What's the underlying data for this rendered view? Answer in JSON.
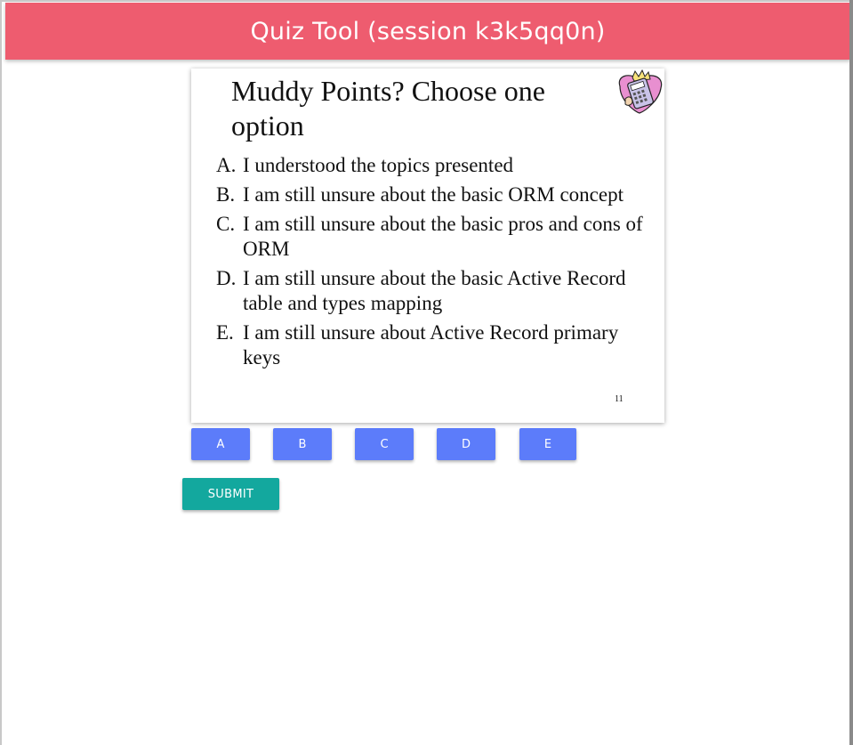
{
  "header": {
    "title": "Quiz Tool (session k3k5qq0n)",
    "color": "#ee5c6f"
  },
  "slide": {
    "title": "Muddy Points? Choose one option",
    "clipart_icon": "calculator-clipart-icon",
    "options": [
      {
        "letter": "A.",
        "text": "I understood the topics presented"
      },
      {
        "letter": "B.",
        "text": "I am still unsure about the basic ORM concept"
      },
      {
        "letter": "C.",
        "text": "I am still unsure about the basic pros and cons of ORM"
      },
      {
        "letter": "D.",
        "text": "I am still unsure about the basic Active Record table and types mapping"
      },
      {
        "letter": "E.",
        "text": "I am still unsure about Active Record primary keys"
      }
    ],
    "page_number": "11"
  },
  "answers": {
    "buttons": [
      "A",
      "B",
      "C",
      "D",
      "E"
    ],
    "color": "#5c7cfa"
  },
  "submit": {
    "label": "SUBMIT",
    "color": "#13a89e"
  }
}
